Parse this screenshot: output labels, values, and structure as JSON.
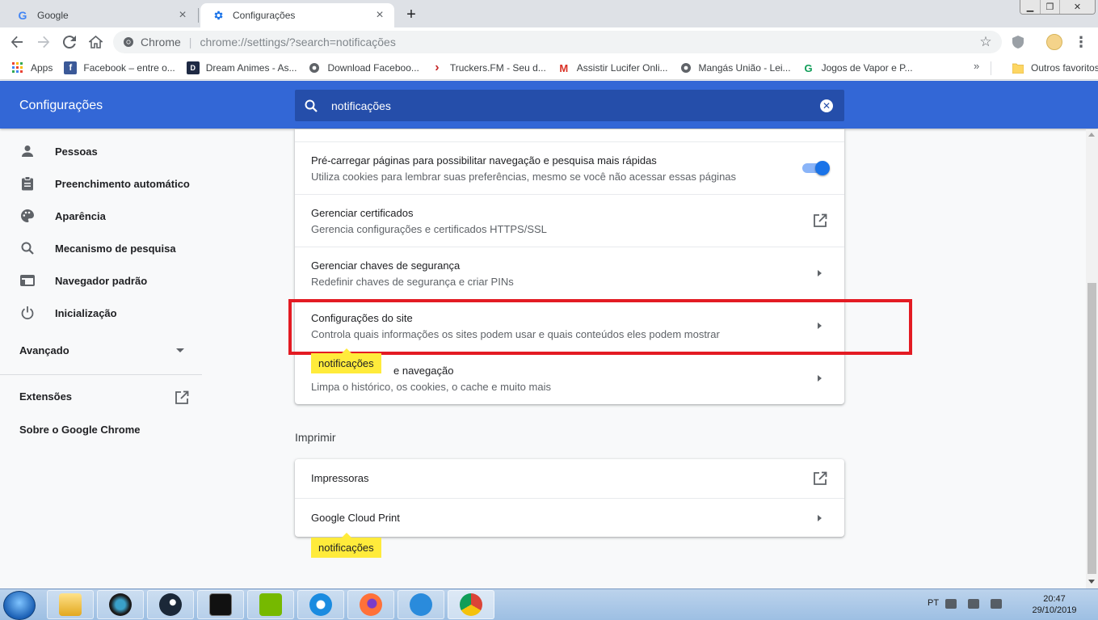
{
  "tabs": [
    {
      "title": "Google",
      "icon": "google-g-icon"
    },
    {
      "title": "Configurações",
      "icon": "gear-icon"
    }
  ],
  "omnibox": {
    "site_label": "Chrome",
    "url_scheme": "chrome://",
    "url_rest": "settings/?search=notificações"
  },
  "bookmarks": [
    {
      "label": "Apps",
      "icon": "apps-grid-icon",
      "color": "#ea4335"
    },
    {
      "label": "Facebook – entre o...",
      "icon": "facebook-icon",
      "color": "#3b5998"
    },
    {
      "label": "Dream Animes - As...",
      "icon": "dream-animes-icon",
      "color": "#1f2a44"
    },
    {
      "label": "Download Faceboo...",
      "icon": "globe-icon",
      "color": "#5f6368"
    },
    {
      "label": "Truckers.FM - Seu d...",
      "icon": "truckers-fm-icon",
      "color": "#c62828"
    },
    {
      "label": "Assistir Lucifer Onli...",
      "icon": "gmail-m-icon",
      "color": "#d93025"
    },
    {
      "label": "Mangás União - Lei...",
      "icon": "globe-icon",
      "color": "#5f6368"
    },
    {
      "label": "Jogos de Vapor e P...",
      "icon": "g-round-icon",
      "color": "#0f9d58"
    }
  ],
  "bookmarks_more": "»",
  "bookmarks_other": "Outros favoritos",
  "settings": {
    "title": "Configurações",
    "search_value": "notificações",
    "accent": "#3367d6",
    "search_bg": "#254eaa"
  },
  "nav": {
    "items": [
      {
        "label": "Pessoas",
        "icon": "person-icon"
      },
      {
        "label": "Preenchimento automático",
        "icon": "clipboard-icon"
      },
      {
        "label": "Aparência",
        "icon": "palette-icon"
      },
      {
        "label": "Mecanismo de pesquisa",
        "icon": "search-icon"
      },
      {
        "label": "Navegador padrão",
        "icon": "browser-window-icon"
      },
      {
        "label": "Inicialização",
        "icon": "power-icon"
      }
    ],
    "advanced": "Avançado",
    "extensions": "Extensões",
    "about": "Sobre o Google Chrome"
  },
  "privacy_rows": [
    {
      "title": "Pré-carregar páginas para possibilitar navegação e pesquisa mais rápidas",
      "subtitle": "Utiliza cookies para lembrar suas preferências, mesmo se você não acessar essas páginas",
      "control": "toggle",
      "enabled": true
    },
    {
      "title": "Gerenciar certificados",
      "subtitle": "Gerencia configurações e certificados HTTPS/SSL",
      "control": "external-link"
    },
    {
      "title": "Gerenciar chaves de segurança",
      "subtitle": "Redefinir chaves de segurança e criar PINs",
      "control": "arrow"
    },
    {
      "title": "Configurações do site",
      "subtitle": "Controla quais informações os sites podem usar e quais conteúdos eles podem mostrar",
      "control": "arrow",
      "highlighted": true
    },
    {
      "title": "e navegação",
      "subtitle": "Limpa o histórico, os cookies, o cache e muito mais",
      "control": "arrow"
    }
  ],
  "print_section": {
    "title": "Imprimir",
    "rows": [
      {
        "title": "Impressoras",
        "control": "external-link"
      },
      {
        "title": "Google Cloud Print",
        "control": "arrow"
      }
    ]
  },
  "search_bubbles": [
    "notificações",
    "notificações"
  ],
  "highlight_color": "#e31b23",
  "taskbar": {
    "apps": [
      "file-explorer-icon",
      "camera-app-icon",
      "steam-icon",
      "command-prompt-icon",
      "nvidia-icon",
      "internet-explorer-icon",
      "firefox-icon",
      "messenger-app-icon",
      "chrome-icon"
    ],
    "lang": "PT",
    "time": "20:47",
    "date": "29/10/2019"
  }
}
